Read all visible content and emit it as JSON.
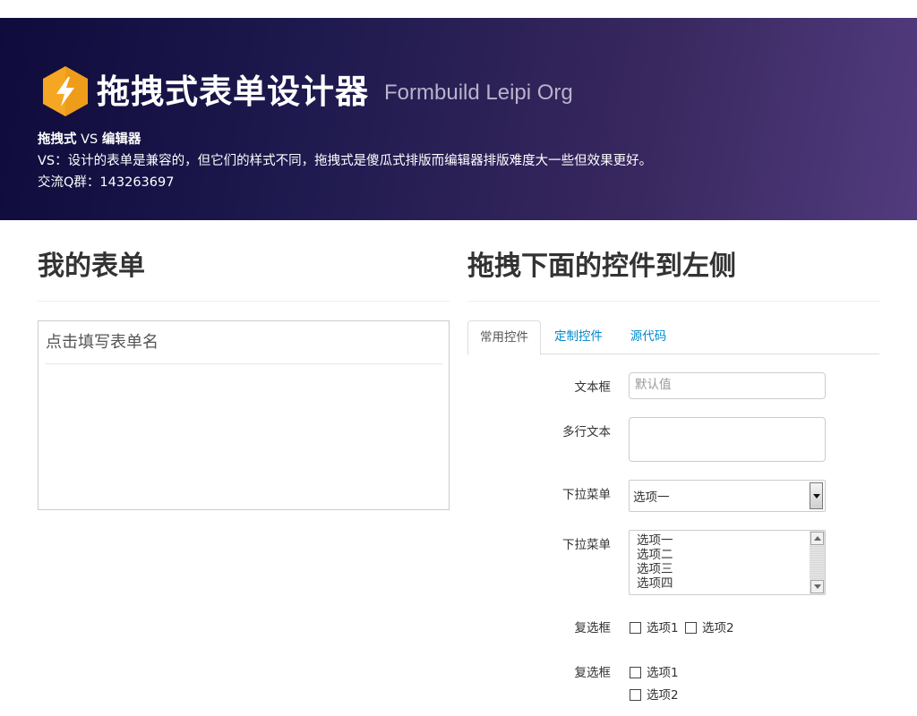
{
  "header": {
    "title": "拖拽式表单设计器",
    "subtitle": "Formbuild Leipi Org",
    "line1_bold1": "拖拽式",
    "line1_vs": " VS ",
    "line1_bold2": "编辑器",
    "line2": "VS：设计的表单是兼容的，但它们的样式不同，拖拽式是傻瓜式排版而编辑器排版难度大一些但效果更好。",
    "line3": "交流Q群：143263697",
    "logo_icon": "lightning-hexagon-logo"
  },
  "left": {
    "title": "我的表单",
    "form_name_placeholder": "点击填写表单名"
  },
  "right": {
    "title": "拖拽下面的控件到左侧",
    "tabs": [
      {
        "label": "常用控件",
        "active": true
      },
      {
        "label": "定制控件",
        "active": false
      },
      {
        "label": "源代码",
        "active": false
      }
    ],
    "controls": {
      "text_label": "文本框",
      "text_placeholder": "默认值",
      "textarea_label": "多行文本",
      "select_label": "下拉菜单",
      "select_value": "选项一",
      "listbox_label": "下拉菜单",
      "listbox_options": [
        "选项一",
        "选项二",
        "选项三",
        "选项四"
      ],
      "checkbox_inline_label": "复选框",
      "checkbox_inline_options": [
        "选项1",
        "选项2"
      ],
      "checkbox_stacked_label": "复选框",
      "checkbox_stacked_options": [
        "选项1",
        "选项2"
      ]
    }
  },
  "colors": {
    "hero_start": "#0f0b3c",
    "hero_end": "#523b7e",
    "link": "#0088cc",
    "logo": "#f5a623"
  }
}
